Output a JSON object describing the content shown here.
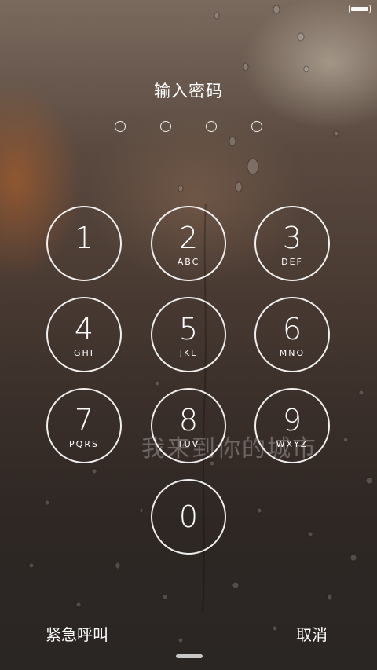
{
  "title": "输入密码",
  "passcode": {
    "length": 4,
    "entered": 0
  },
  "keypad": [
    {
      "digit": "1",
      "letters": ""
    },
    {
      "digit": "2",
      "letters": "ABC"
    },
    {
      "digit": "3",
      "letters": "DEF"
    },
    {
      "digit": "4",
      "letters": "GHI"
    },
    {
      "digit": "5",
      "letters": "JKL"
    },
    {
      "digit": "6",
      "letters": "MNO"
    },
    {
      "digit": "7",
      "letters": "PQRS"
    },
    {
      "digit": "8",
      "letters": "TUV"
    },
    {
      "digit": "9",
      "letters": "WXYZ"
    },
    {
      "digit": "0",
      "letters": ""
    }
  ],
  "watermark": "我来到你的城市",
  "footer": {
    "emergency_label": "紧急呼叫",
    "cancel_label": "取消"
  },
  "colors": {
    "foreground": "#ffffff"
  }
}
